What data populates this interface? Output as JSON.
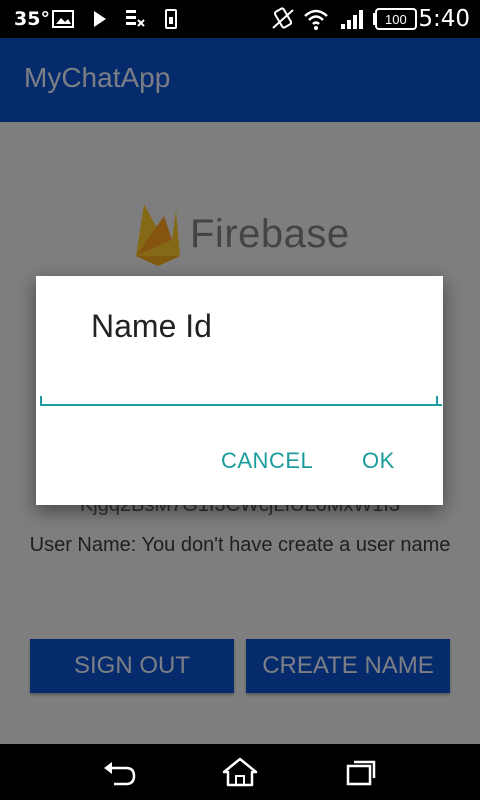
{
  "status_bar": {
    "temperature": "35°",
    "battery": "100",
    "time": "5:40"
  },
  "app_bar": {
    "title": "MyChatApp"
  },
  "content": {
    "logo_text": "Firebase",
    "uid_text": "Kjgq2BsM7G1I3CWcjLIUL6MxW1I3",
    "username_text": "User Name: You don't have create a user name"
  },
  "buttons": {
    "sign_out": "SIGN OUT",
    "create_name": "CREATE NAME"
  },
  "dialog": {
    "title": "Name Id",
    "input_value": "",
    "cancel_label": "CANCEL",
    "ok_label": "OK"
  },
  "colors": {
    "primary": "#0a4fc6",
    "accent": "#1a9c9c",
    "firebase_yellow": "#f5c02a",
    "firebase_orange": "#f39a1e"
  }
}
